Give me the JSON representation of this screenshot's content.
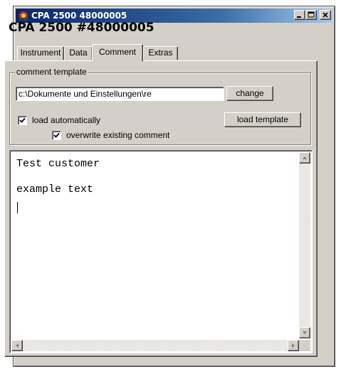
{
  "window": {
    "title": "CPA 2500 48000005",
    "app_icon": "app-icon",
    "controls": [
      "minimize-icon",
      "maximize-icon",
      "close-icon"
    ]
  },
  "header": {
    "title": "CPA 2500 #48000005"
  },
  "tabs": [
    {
      "label": "Instrument",
      "active": false
    },
    {
      "label": "Data",
      "active": false
    },
    {
      "label": "Comment",
      "active": true
    },
    {
      "label": "Extras",
      "active": false
    }
  ],
  "comment_template": {
    "group_label": "comment template",
    "path_value": "c:\\Dokumente und Einstellungen\\re",
    "change_label": "change",
    "load_automatically_label": "load automatically",
    "load_automatically_checked": true,
    "load_template_label": "load template",
    "overwrite_label": "overwrite existing comment",
    "overwrite_checked": true
  },
  "editor": {
    "text": "Test customer\n\nexample text"
  },
  "colors": {
    "titlebar_start": "#0a246a",
    "titlebar_end": "#a6caf0",
    "face": "#d4d0c8"
  }
}
